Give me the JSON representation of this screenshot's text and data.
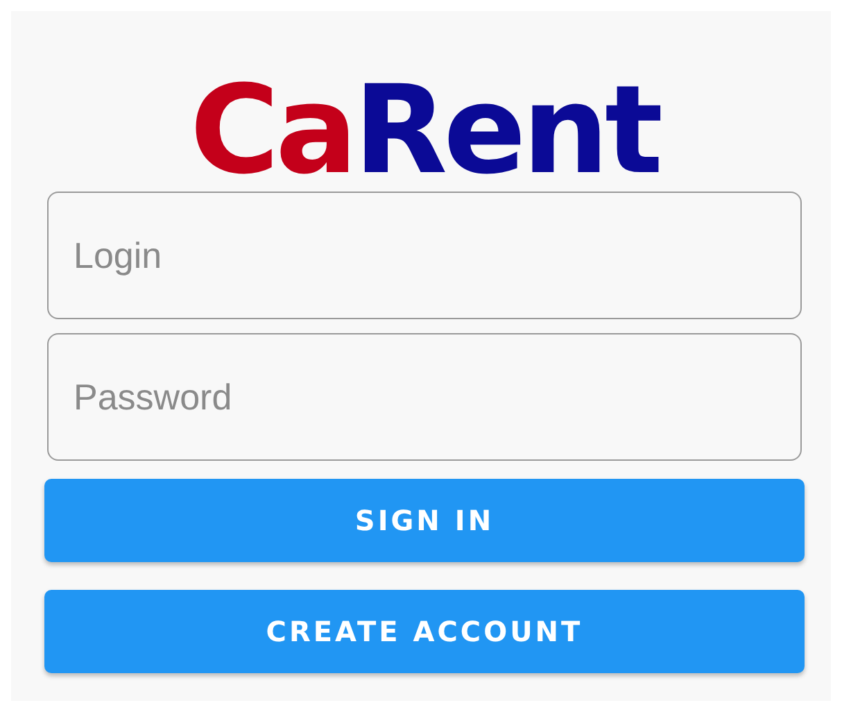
{
  "logo": {
    "parts": [
      {
        "text": "Ca",
        "color": "#c4001a"
      },
      {
        "text": "Rent",
        "color": "#0b0a96"
      }
    ]
  },
  "fields": [
    {
      "placeholder": "Login"
    },
    {
      "placeholder": "Password"
    }
  ],
  "buttons": [
    "SIGN IN",
    "CREATE ACCOUNT"
  ]
}
